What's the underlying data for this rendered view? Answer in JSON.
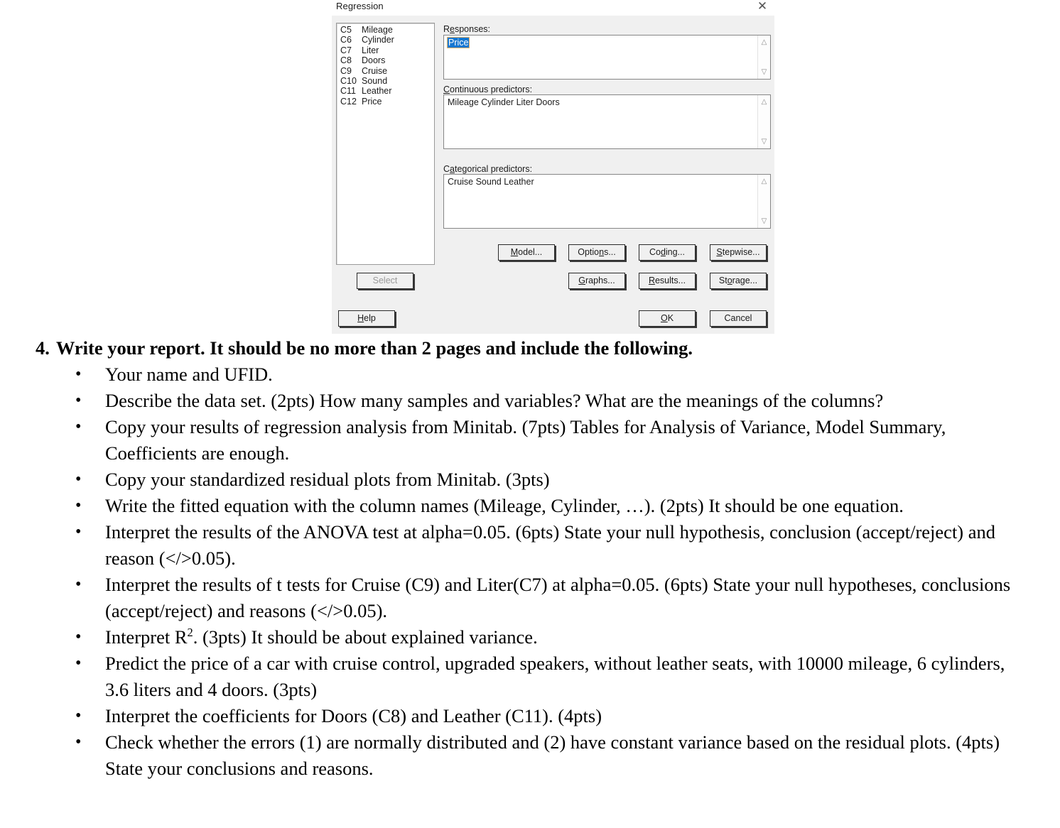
{
  "dialog": {
    "title": "Regression",
    "close_icon": "close-icon",
    "variables": [
      {
        "code": "C5",
        "name": "Mileage"
      },
      {
        "code": "C6",
        "name": "Cylinder"
      },
      {
        "code": "C7",
        "name": "Liter"
      },
      {
        "code": "C8",
        "name": "Doors"
      },
      {
        "code": "C9",
        "name": "Cruise"
      },
      {
        "code": "C10",
        "name": "Sound"
      },
      {
        "code": "C11",
        "name": "Leather"
      },
      {
        "code": "C12",
        "name": "Price"
      }
    ],
    "fields": {
      "responses": {
        "label_pre": "R",
        "label_mn": "e",
        "label_post": "sponses:",
        "value": "Price",
        "value_selected": true
      },
      "continuous_predictors": {
        "label_pre": "",
        "label_mn": "C",
        "label_post": "ontinuous predictors:",
        "value": "Mileage Cylinder Liter Doors",
        "value_selected": false
      },
      "categorical_predictors": {
        "label_pre": "C",
        "label_mn": "a",
        "label_post": "tegorical predictors:",
        "value": "Cruise Sound Leather",
        "value_selected": false
      }
    },
    "scroll_up_icon": "chevron-up-icon",
    "scroll_down_icon": "chevron-down-icon",
    "buttons": {
      "select": {
        "pre": "",
        "mn": "",
        "post": "Select",
        "disabled": true
      },
      "help": {
        "pre": "",
        "mn": "H",
        "post": "elp",
        "disabled": false
      },
      "model": {
        "pre": "",
        "mn": "M",
        "post": "odel...",
        "disabled": false
      },
      "options": {
        "pre": "Optio",
        "mn": "n",
        "post": "s...",
        "disabled": false
      },
      "coding": {
        "pre": "Co",
        "mn": "d",
        "post": "ing...",
        "disabled": false
      },
      "stepwise": {
        "pre": "",
        "mn": "S",
        "post": "tepwise...",
        "disabled": false
      },
      "graphs": {
        "pre": "",
        "mn": "G",
        "post": "raphs...",
        "disabled": false
      },
      "results": {
        "pre": "",
        "mn": "R",
        "post": "esults...",
        "disabled": false
      },
      "storage": {
        "pre": "St",
        "mn": "o",
        "post": "rage...",
        "disabled": false
      },
      "ok": {
        "pre": "",
        "mn": "O",
        "post": "K",
        "disabled": false
      },
      "cancel": {
        "pre": "Cancel",
        "mn": "",
        "post": "",
        "disabled": false
      }
    },
    "colors": {
      "dialog_background": "#f0f0f0",
      "field_background": "#ffffff",
      "selection_blue": "#1477d1",
      "selection_border": "#e8b06a",
      "border_gray": "#868686",
      "disabled_text": "#9a9a9a"
    }
  },
  "assignment": {
    "heading_number": "4.",
    "heading_text": "Write your report.  It should be no more than 2 pages and include the following.",
    "bullets": [
      "Your name and UFID.",
      "Describe the data set. (2pts) How many samples and variables? What are the meanings of the columns?",
      "Copy your results of regression analysis from Minitab. (7pts) Tables for Analysis of Variance, Model Summary, Coefficients are enough.",
      "Copy your standardized residual plots from Minitab. (3pts)",
      "Write the fitted equation with the column names (Mileage, Cylinder, …). (2pts) It should be one equation.",
      "Interpret the results of the ANOVA test at alpha=0.05. (6pts) State your null hypothesis, conclusion (accept/reject) and reason (</>0.05).",
      "Interpret the results of t tests for Cruise (C9) and Liter(C7) at alpha=0.05. (6pts) State your null hypotheses, conclusions (accept/reject) and reasons (</>0.05).",
      "",
      "Predict the price of a car with cruise control, upgraded speakers, without leather seats, with 10000 mileage, 6 cylinders, 3.6 liters and 4 doors. (3pts)",
      "Interpret the coefficients for Doors (C8) and Leather (C11). (4pts)",
      "Check whether the errors (1) are normally distributed and (2) have constant variance based on the residual plots. (4pts) State your conclusions and reasons."
    ],
    "bullet_r_squared": {
      "pre": "Interpret R",
      "sup": "2",
      "post": ". (3pts) It should be about explained variance."
    }
  }
}
